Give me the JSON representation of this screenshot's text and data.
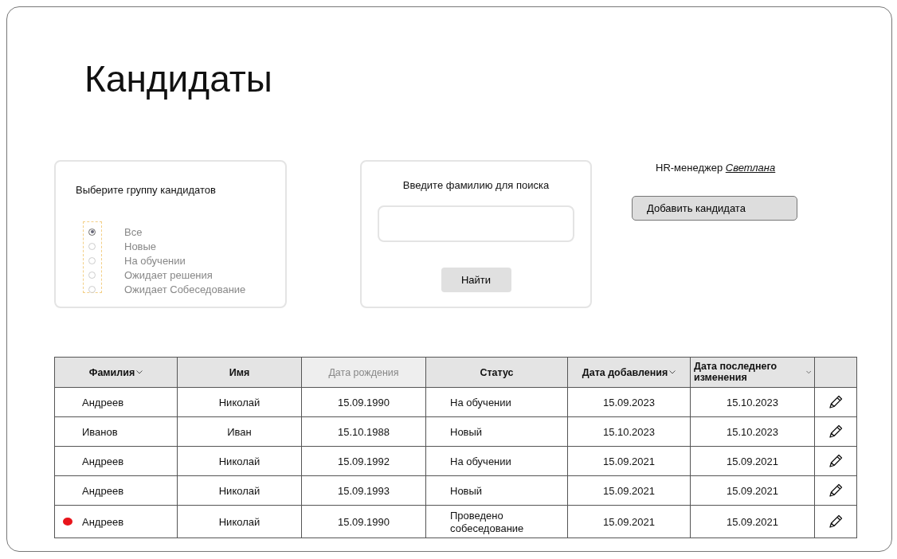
{
  "title": "Кандидаты",
  "group_filter": {
    "label": "Выберите группу кандидатов",
    "options": [
      {
        "label": "Все",
        "selected": true
      },
      {
        "label": "Новые",
        "selected": false
      },
      {
        "label": "На обучении",
        "selected": false
      },
      {
        "label": "Ожидает решения",
        "selected": false
      },
      {
        "label": "Ожидает Собеседование",
        "selected": false
      }
    ]
  },
  "search": {
    "label": "Введите фамилию для поиска",
    "button": "Найти"
  },
  "user": {
    "role": "HR-менеджер",
    "name": "Светлана"
  },
  "add_button": "Добавить кандидата",
  "table": {
    "columns": [
      {
        "label": "Фамилия",
        "sortable": true,
        "disabled": false
      },
      {
        "label": "Имя",
        "sortable": false,
        "disabled": false
      },
      {
        "label": "Дата рождения",
        "sortable": false,
        "disabled": true
      },
      {
        "label": "Статус",
        "sortable": false,
        "disabled": false
      },
      {
        "label": "Дата добавления",
        "sortable": true,
        "disabled": false
      },
      {
        "label": "Дата последнего изменения",
        "sortable": true,
        "disabled": false
      }
    ],
    "rows": [
      {
        "marked": false,
        "cells": [
          "Андреев",
          "Николай",
          "15.09.1990",
          "На обучении",
          "15.09.2023",
          "15.10.2023"
        ]
      },
      {
        "marked": false,
        "cells": [
          "Иванов",
          "Иван",
          "15.10.1988",
          "Новый",
          "15.10.2023",
          "15.10.2023"
        ]
      },
      {
        "marked": false,
        "cells": [
          "Андреев",
          "Николай",
          "15.09.1992",
          "На обучении",
          "15.09.2021",
          "15.09.2021"
        ]
      },
      {
        "marked": false,
        "cells": [
          "Андреев",
          "Николай",
          "15.09.1993",
          "Новый",
          "15.09.2021",
          "15.09.2021"
        ]
      },
      {
        "marked": true,
        "cells": [
          "Андреев",
          "Николай",
          "15.09.1990",
          "Проведено собеседование",
          "15.09.2021",
          "15.09.2021"
        ]
      }
    ]
  }
}
